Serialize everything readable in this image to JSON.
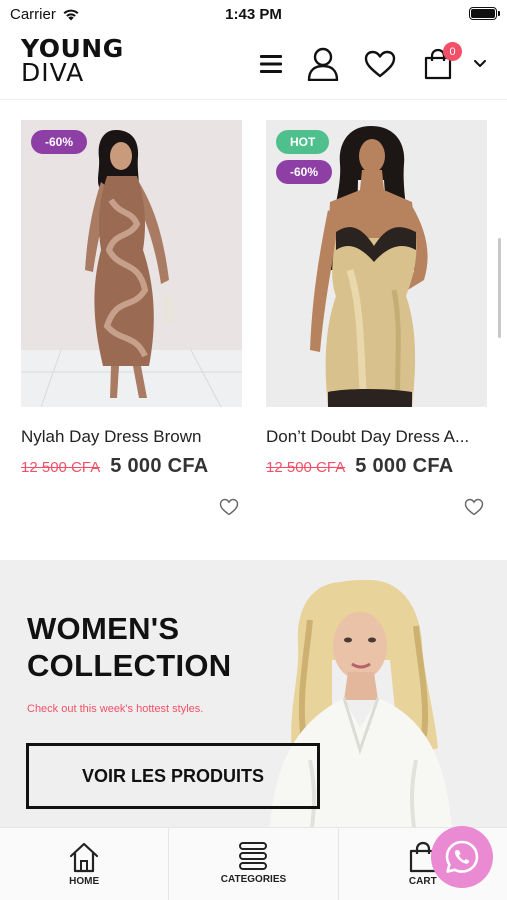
{
  "status_bar": {
    "carrier": "Carrier",
    "time": "1:43 PM"
  },
  "header": {
    "logo_top": "YOUNG",
    "logo_bottom": "DIVA",
    "cart_count": "0",
    "icons": [
      "menu-icon",
      "user-icon",
      "heart-icon",
      "cart-icon",
      "chevron-down-icon"
    ]
  },
  "products": [
    {
      "name": "Nylah Day Dress Brown",
      "old_price": "12 500 CFA",
      "new_price": "5 000 CFA",
      "badges": [
        "-60%"
      ]
    },
    {
      "name": "Don’t Doubt Day Dress A...",
      "old_price": "12 500 CFA",
      "new_price": "5 000 CFA",
      "badges": [
        "HOT",
        "-60%"
      ]
    }
  ],
  "banner": {
    "title_line1": "WOMEN'S",
    "title_line2": "COLLECTION",
    "subtitle": "Check out this week's hottest styles.",
    "button_label": "VOIR LES PRODUITS"
  },
  "bottom_nav": {
    "items": [
      {
        "label": "HOME",
        "icon": "home-icon"
      },
      {
        "label": "CATEGORIES",
        "icon": "categories-icon"
      },
      {
        "label": "CART",
        "icon": "cart-icon"
      }
    ]
  },
  "colors": {
    "accent_pink": "#f25068",
    "sale_badge": "#8e3fa6",
    "hot_badge": "#4fc08d",
    "whatsapp_button": "#e98ad3"
  }
}
